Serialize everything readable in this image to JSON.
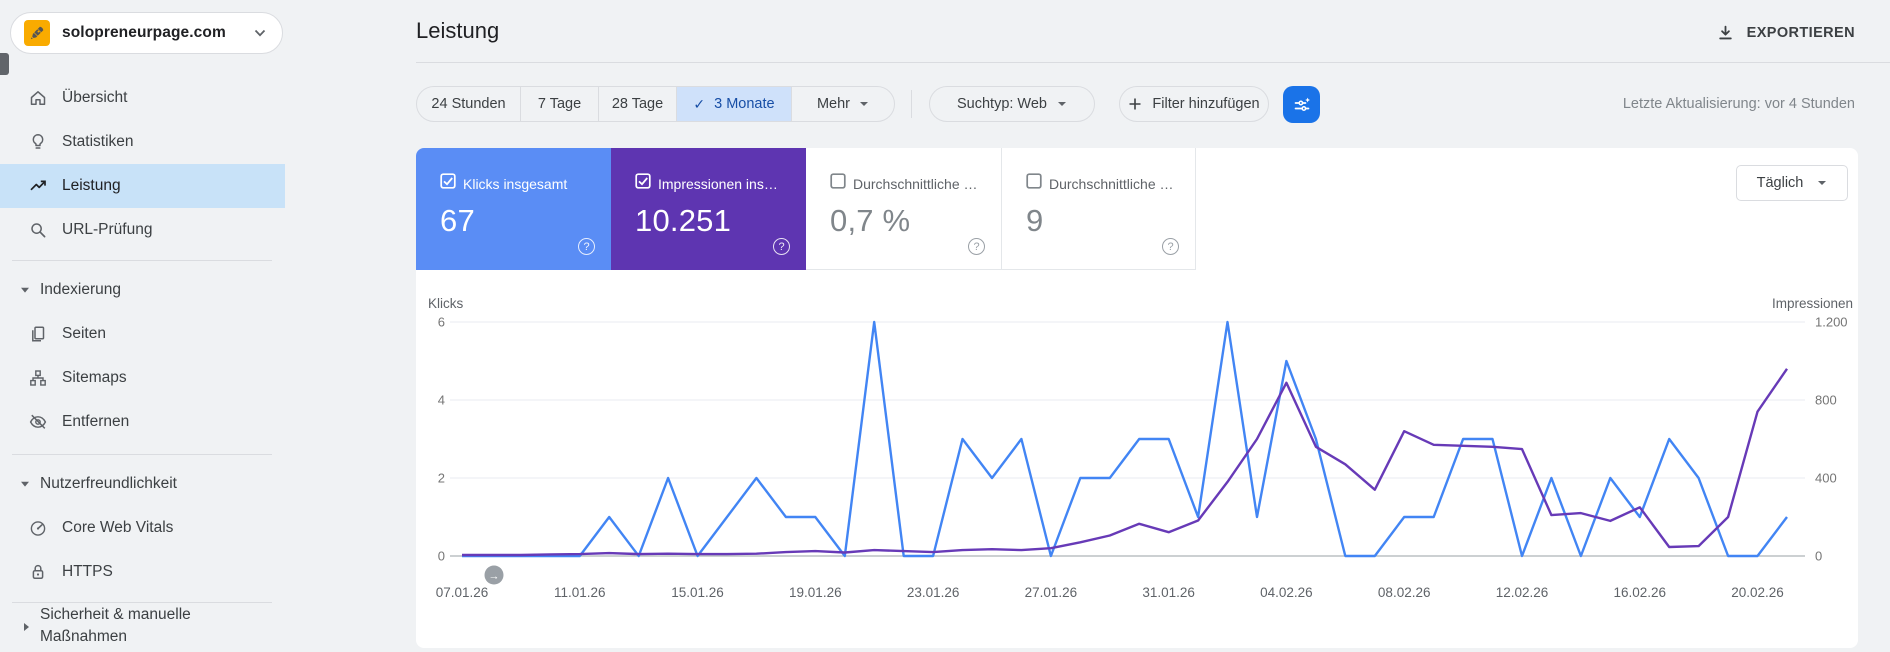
{
  "property_selector": {
    "name": "solopreneurpage.com",
    "icon": "rocket-icon"
  },
  "sidebar": {
    "items": [
      {
        "label": "Übersicht",
        "icon": "home-icon"
      },
      {
        "label": "Statistiken",
        "icon": "lightbulb-icon"
      },
      {
        "label": "Leistung",
        "icon": "trending-up-icon",
        "selected": true
      },
      {
        "label": "URL-Prüfung",
        "icon": "search-icon"
      },
      {
        "label": "Indexierung",
        "icon": "caret-down-icon",
        "type": "section"
      },
      {
        "label": "Seiten",
        "icon": "pages-icon"
      },
      {
        "label": "Sitemaps",
        "icon": "sitemap-icon"
      },
      {
        "label": "Entfernen",
        "icon": "eye-off-icon"
      },
      {
        "label": "Nutzerfreundlichkeit",
        "icon": "caret-down-icon",
        "type": "section"
      },
      {
        "label": "Core Web Vitals",
        "icon": "gauge-icon"
      },
      {
        "label": "HTTPS",
        "icon": "lock-icon"
      },
      {
        "label": "Sicherheit & manuelle Maßnahmen",
        "icon": "caret-right-icon",
        "type": "section-collapsed"
      }
    ]
  },
  "header": {
    "title": "Leistung",
    "export_label": "EXPORTIEREN"
  },
  "toolbar": {
    "range_chips": [
      "24 Stunden",
      "7 Tage",
      "28 Tage",
      "3 Monate"
    ],
    "selected_chip": "3 Monate",
    "more_label": "Mehr",
    "search_type_label": "Suchtyp: Web",
    "add_filter_label": "Filter hinzufügen",
    "last_update": "Letzte Aktualisierung: vor 4 Stunden"
  },
  "cards": [
    {
      "title": "Klicks insgesamt",
      "value": "67",
      "checked": true,
      "color": "#5a8df5"
    },
    {
      "title": "Impressionen ins…",
      "value": "10.251",
      "checked": true,
      "color": "#5e35b1"
    },
    {
      "title": "Durchschnittliche …",
      "value": "0,7 %",
      "checked": false
    },
    {
      "title": "Durchschnittliche …",
      "value": "9",
      "checked": false
    }
  ],
  "granularity": {
    "label": "Täglich"
  },
  "colors": {
    "accent_blue": "#1a73e8",
    "clicks_line": "#4285f4",
    "impressions_line": "#673ab7",
    "selected_chip_bg": "#cfe1fa",
    "selected_nav_bg": "#c8e2f8"
  },
  "chart_data": {
    "type": "line",
    "title": "",
    "grid": true,
    "legend_position": "none",
    "dates": [
      "07.01.26",
      "08.01.26",
      "09.01.26",
      "10.01.26",
      "11.01.26",
      "12.01.26",
      "13.01.26",
      "14.01.26",
      "15.01.26",
      "16.01.26",
      "17.01.26",
      "18.01.26",
      "19.01.26",
      "20.01.26",
      "21.01.26",
      "22.01.26",
      "23.01.26",
      "24.01.26",
      "25.01.26",
      "26.01.26",
      "27.01.26",
      "28.01.26",
      "29.01.26",
      "30.01.26",
      "31.01.26",
      "01.02.26",
      "02.02.26",
      "03.02.26",
      "04.02.26",
      "05.02.26",
      "06.02.26",
      "07.02.26",
      "08.02.26",
      "09.02.26",
      "10.02.26",
      "11.02.26",
      "12.02.26",
      "13.02.26",
      "14.02.26",
      "15.02.26",
      "16.02.26",
      "17.02.26",
      "18.02.26",
      "19.02.26",
      "20.02.26",
      "21.02.26"
    ],
    "x_tick_labels": [
      "07.01.26",
      "11.01.26",
      "15.01.26",
      "19.01.26",
      "23.01.26",
      "27.01.26",
      "31.01.26",
      "04.02.26",
      "08.02.26",
      "12.02.26",
      "16.02.26",
      "20.02.26"
    ],
    "left_axis": {
      "label": "Klicks",
      "ticks": [
        0,
        2,
        4,
        6
      ],
      "tick_labels": [
        "0",
        "2",
        "4",
        "6"
      ],
      "max": 6
    },
    "right_axis": {
      "label": "Impressionen",
      "ticks": [
        0,
        400,
        800,
        1200
      ],
      "tick_labels": [
        "0",
        "400",
        "800",
        "1.200"
      ],
      "max": 1200
    },
    "series": [
      {
        "name": "Klicks",
        "axis": "left",
        "color": "#4285f4",
        "values": [
          0,
          0,
          0,
          0,
          0,
          1,
          0,
          2,
          0,
          1,
          2,
          1,
          1,
          0,
          6,
          0,
          0,
          3,
          2,
          3,
          0,
          2,
          2,
          3,
          3,
          1,
          6,
          1,
          5,
          3,
          0,
          0,
          1,
          1,
          3,
          3,
          0,
          2,
          0,
          2,
          1,
          3,
          2,
          0,
          0,
          1
        ]
      },
      {
        "name": "Impressionen",
        "axis": "right",
        "color": "#673ab7",
        "values": [
          5,
          5,
          5,
          8,
          10,
          15,
          10,
          12,
          10,
          10,
          12,
          20,
          25,
          18,
          30,
          25,
          20,
          30,
          35,
          30,
          40,
          70,
          105,
          165,
          122,
          182,
          380,
          600,
          888,
          560,
          470,
          340,
          640,
          570,
          565,
          560,
          548,
          210,
          220,
          180,
          250,
          46,
          51,
          200,
          740,
          960
        ]
      }
    ]
  }
}
